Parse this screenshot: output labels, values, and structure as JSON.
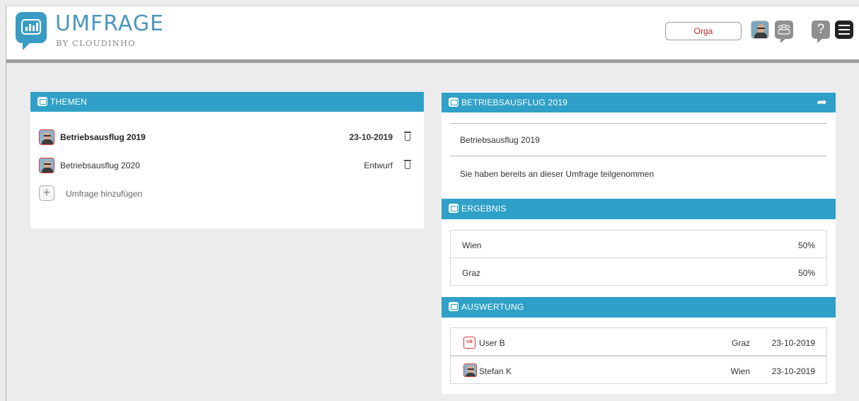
{
  "app": {
    "title": "UMFRAGE",
    "subtitle": "BY CLOUDINHO"
  },
  "header": {
    "orga_label": "Orga",
    "help_glyph": "?",
    "icons": [
      "avatar",
      "group-icon",
      "help-icon",
      "menu-icon"
    ]
  },
  "colors": {
    "accent": "#2fa0c7",
    "header_bar": "#9c9c9c",
    "danger": "#c8282d"
  },
  "themen": {
    "heading": "THEMEN",
    "items": [
      {
        "label": "Betriebsausflug 2019",
        "status": "23-10-2019",
        "bold": true
      },
      {
        "label": "Betriebsausflug 2020",
        "status": "Entwurf",
        "bold": false
      }
    ],
    "add_label": "Umfrage hinzufügen",
    "add_glyph": "+"
  },
  "detail": {
    "heading": "BETRIEBSAUSFLUG 2019",
    "share_glyph": "➦",
    "title": "Betriebsausflug 2019",
    "message": "Sie haben bereits an dieser Umfrage teilgenommen"
  },
  "ergebnis": {
    "heading": "ERGEBNIS",
    "rows": [
      {
        "label": "Wien",
        "value": "50%"
      },
      {
        "label": "Graz",
        "value": "50%"
      }
    ]
  },
  "auswertung": {
    "heading": "AUSWERTUNG",
    "rows": [
      {
        "badge": "UB",
        "user": "User B",
        "choice": "Graz",
        "date": "23-10-2019"
      },
      {
        "badge": "",
        "user": "Stefan K",
        "choice": "Wien",
        "date": "23-10-2019"
      }
    ]
  }
}
